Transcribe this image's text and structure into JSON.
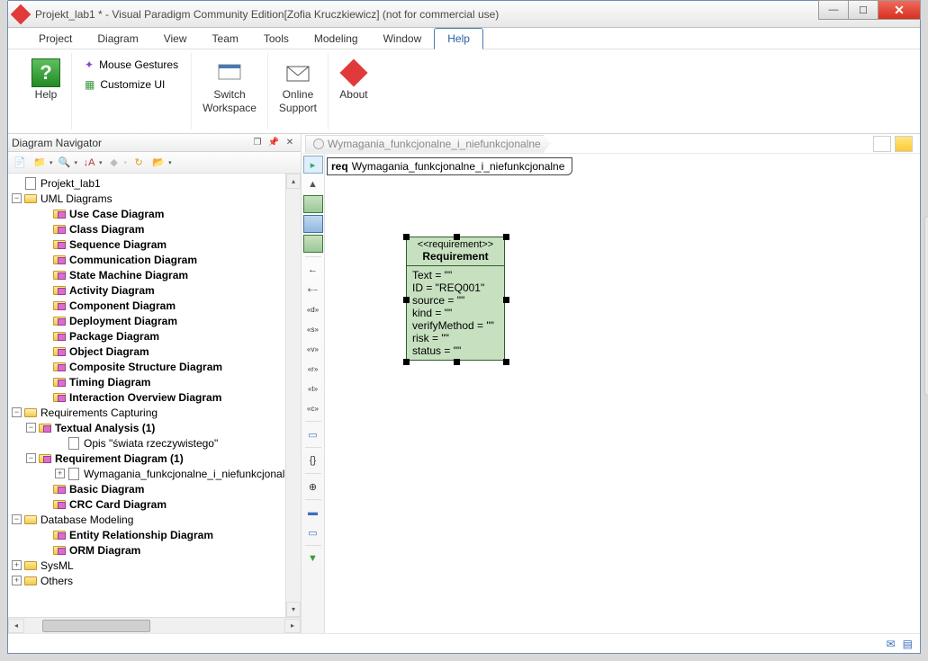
{
  "window": {
    "title": "Projekt_lab1 * - Visual Paradigm Community Edition[Zofia Kruczkiewicz] (not for commercial use)"
  },
  "menubar": {
    "items": [
      "Project",
      "Diagram",
      "View",
      "Team",
      "Tools",
      "Modeling",
      "Window",
      "Help"
    ],
    "active": 7
  },
  "ribbon": {
    "help": "Help",
    "gestures": "Mouse Gestures",
    "customize": "Customize UI",
    "switch1": "Switch",
    "switch2": "Workspace",
    "online1": "Online",
    "online2": "Support",
    "about": "About"
  },
  "nav": {
    "title": "Diagram Navigator",
    "tree": {
      "root": "Projekt_lab1",
      "uml": "UML Diagrams",
      "uml_items": [
        "Use Case Diagram",
        "Class Diagram",
        "Sequence Diagram",
        "Communication Diagram",
        "State Machine Diagram",
        "Activity Diagram",
        "Component Diagram",
        "Deployment Diagram",
        "Package Diagram",
        "Object Diagram",
        "Composite Structure Diagram",
        "Timing Diagram",
        "Interaction Overview Diagram"
      ],
      "req": "Requirements Capturing",
      "textual": "Textual Analysis (1)",
      "textual_child": "Opis \"świata rzeczywistego\"",
      "reqdiag": "Requirement Diagram (1)",
      "reqdiag_child": "Wymagania_funkcjonalne_i_niefunkcjonalne",
      "basic": "Basic Diagram",
      "crc": "CRC Card Diagram",
      "db": "Database Modeling",
      "erd": "Entity Relationship Diagram",
      "orm": "ORM Diagram",
      "sysml": "SysML",
      "others": "Others"
    }
  },
  "breadcrumb": {
    "label": "Wymagania_funkcjonalne_i_niefunkcjonalne"
  },
  "reqtab": {
    "kw": "req",
    "name": "Wymagania_funkcjonalne_i_niefunkcjonalne"
  },
  "shape": {
    "stereo": "<<requirement>>",
    "name": "Requirement",
    "attrs": [
      "Text = \"\"",
      "ID = \"REQ001\"",
      "source = \"\"",
      "kind = \"\"",
      "verifyMethod = \"\"",
      "risk = \"\"",
      "status = \"\""
    ]
  }
}
